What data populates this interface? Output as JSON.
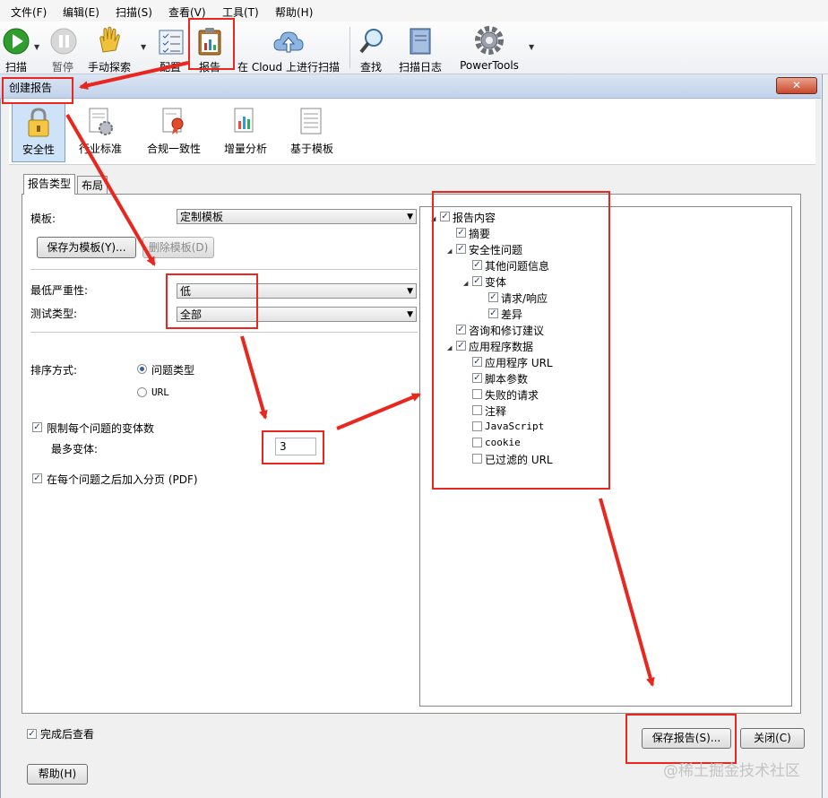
{
  "menubar": {
    "file": "文件(F)",
    "edit": "编辑(E)",
    "scan": "扫描(S)",
    "view": "查看(V)",
    "tools": "工具(T)",
    "help": "帮助(H)"
  },
  "toolbar": {
    "scan": "扫描",
    "pause": "暂停",
    "manual_explore": "手动探索",
    "config": "配置",
    "report": "报告",
    "cloud_scan": "在 Cloud 上进行扫描",
    "find": "查找",
    "scan_log": "扫描日志",
    "powertools": "PowerTools"
  },
  "dialog": {
    "title": "创建报告",
    "close": "✕"
  },
  "categories": {
    "security": "安全性",
    "industry": "行业标准",
    "compliance": "合规一致性",
    "delta": "增量分析",
    "template": "基于模板"
  },
  "tabs": {
    "report_type": "报告类型",
    "layout": "布局"
  },
  "form": {
    "template_label": "模板:",
    "template_value": "定制模板",
    "save_as_template": "保存为模板(Y)...",
    "delete_template": "删除模板(D)",
    "min_severity_label": "最低严重性:",
    "min_severity_value": "低",
    "test_type_label": "测试类型:",
    "test_type_value": "全部",
    "sort_label": "排序方式:",
    "sort_issue_type": "问题类型",
    "sort_url": "URL",
    "limit_variants": "限制每个问题的变体数",
    "max_variants_label": "最多变体:",
    "max_variants_value": "3",
    "page_break": "在每个问题之后加入分页 (PDF)"
  },
  "tree": {
    "root": "报告内容",
    "summary": "摘要",
    "security_issues": "安全性问题",
    "other_issue_info": "其他问题信息",
    "variants": "变体",
    "request_response": "请求/响应",
    "diff": "差异",
    "advisories": "咨询和修订建议",
    "app_data": "应用程序数据",
    "app_url": "应用程序 URL",
    "script_params": "脚本参数",
    "failed_requests": "失败的请求",
    "comments": "注释",
    "javascript": "JavaScript",
    "cookie": "cookie",
    "filtered_url": "已过滤的 URL"
  },
  "footer": {
    "view_after": "完成后查看",
    "save_report": "保存报告(S)...",
    "close": "关闭(C)",
    "help": "帮助(H)"
  },
  "watermark": "@稀土掘金技术社区",
  "colors": {
    "annotation_red": "#e8271f",
    "selection_blue": "#cfe3f8"
  }
}
